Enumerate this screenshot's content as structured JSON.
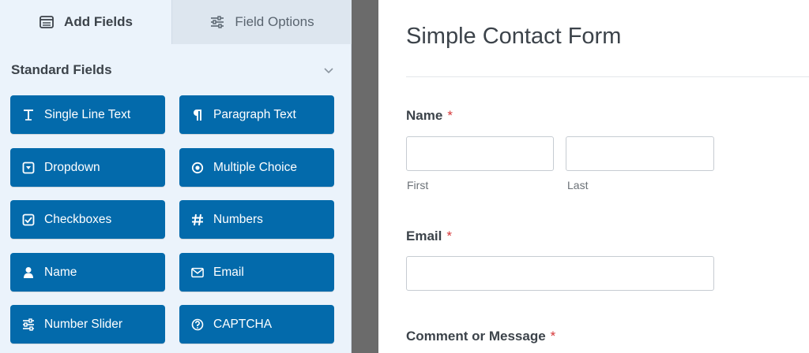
{
  "tabs": {
    "add_fields": "Add Fields",
    "field_options": "Field Options"
  },
  "section": {
    "title": "Standard Fields"
  },
  "fields": [
    {
      "label": "Single Line Text",
      "icon": "text-icon"
    },
    {
      "label": "Paragraph Text",
      "icon": "pilcrow-icon"
    },
    {
      "label": "Dropdown",
      "icon": "dropdown-icon"
    },
    {
      "label": "Multiple Choice",
      "icon": "radio-icon"
    },
    {
      "label": "Checkboxes",
      "icon": "checkbox-icon"
    },
    {
      "label": "Numbers",
      "icon": "hash-icon"
    },
    {
      "label": "Name",
      "icon": "user-icon"
    },
    {
      "label": "Email",
      "icon": "envelope-icon"
    },
    {
      "label": "Number Slider",
      "icon": "sliders-icon"
    },
    {
      "label": "CAPTCHA",
      "icon": "question-circle-icon"
    }
  ],
  "form": {
    "title": "Simple Contact Form",
    "name_label": "Name",
    "first_sublabel": "First",
    "last_sublabel": "Last",
    "email_label": "Email",
    "comment_label": "Comment or Message",
    "required_mark": "*"
  },
  "colors": {
    "button_bg": "#036aab",
    "panel_bg": "#ebf3fb",
    "required": "#d63638",
    "divider": "#6b6b6b"
  }
}
